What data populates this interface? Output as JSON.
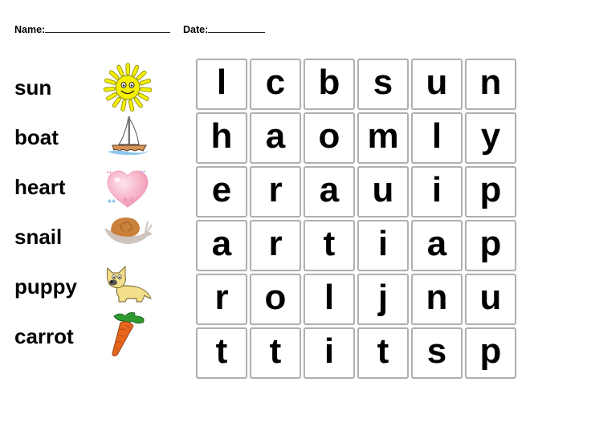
{
  "header": {
    "name_label": "Name:",
    "date_label": "Date:"
  },
  "words": [
    {
      "word": "sun",
      "picture": "sun-icon"
    },
    {
      "word": "boat",
      "picture": "sailboat-icon"
    },
    {
      "word": "heart",
      "picture": "heart-icon"
    },
    {
      "word": "snail",
      "picture": "snail-icon"
    },
    {
      "word": "puppy",
      "picture": "puppy-icon"
    },
    {
      "word": "carrot",
      "picture": "carrot-icon"
    }
  ],
  "grid": [
    [
      "l",
      "c",
      "b",
      "s",
      "u",
      "n"
    ],
    [
      "h",
      "a",
      "o",
      "m",
      "l",
      "y"
    ],
    [
      "e",
      "r",
      "a",
      "u",
      "i",
      "p"
    ],
    [
      "a",
      "r",
      "t",
      "i",
      "a",
      "p"
    ],
    [
      "r",
      "o",
      "l",
      "j",
      "n",
      "u"
    ],
    [
      "t",
      "t",
      "i",
      "t",
      "s",
      "p"
    ]
  ],
  "colors": {
    "cell_border": "#b0b0b0",
    "sun": "#f4f000",
    "heart": "#f7b4c8",
    "snail_shell": "#c9803a",
    "puppy": "#f3df8a",
    "carrot": "#e8661e",
    "carrot_leaves": "#2f9a2f"
  }
}
